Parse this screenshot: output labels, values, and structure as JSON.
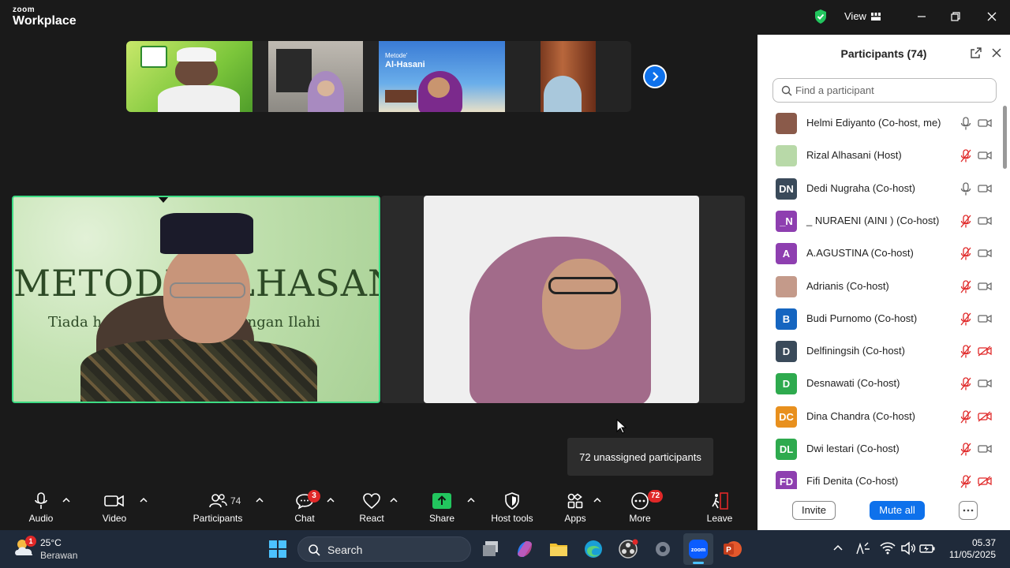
{
  "app": {
    "brand_top": "zoom",
    "brand_bottom": "Workplace",
    "view_label": "View"
  },
  "main": {
    "tooltip": "72 unassigned participants"
  },
  "toolbar": {
    "audio": "Audio",
    "video": "Video",
    "participants": "Participants",
    "participants_count": "74",
    "chat": "Chat",
    "chat_badge": "3",
    "react": "React",
    "share": "Share",
    "host_tools": "Host tools",
    "apps": "Apps",
    "more": "More",
    "more_badge": "72",
    "leave": "Leave"
  },
  "panel": {
    "title": "Participants (74)",
    "search_placeholder": "Find a participant",
    "invite": "Invite",
    "mute_all": "Mute all",
    "participants": [
      {
        "name": "Helmi Ediyanto (Co-host, me)",
        "initials": "",
        "color": "#8a5a4a",
        "mic": "on",
        "cam": "on"
      },
      {
        "name": "Rizal Alhasani (Host)",
        "initials": "",
        "color": "#b8d9a8",
        "mic": "muted",
        "cam": "on"
      },
      {
        "name": "Dedi  Nugraha (Co-host)",
        "initials": "DN",
        "color": "#3a4a5a",
        "mic": "on",
        "cam": "on"
      },
      {
        "name": "_ NURAENI (AINI ) (Co-host)",
        "initials": "_N",
        "color": "#8e3fb0",
        "mic": "muted",
        "cam": "on"
      },
      {
        "name": "A.AGUSTINA (Co-host)",
        "initials": "A",
        "color": "#8e3fb0",
        "mic": "muted",
        "cam": "on"
      },
      {
        "name": "Adrianis (Co-host)",
        "initials": "",
        "color": "#c49a8a",
        "mic": "muted",
        "cam": "on"
      },
      {
        "name": "Budi Purnomo (Co-host)",
        "initials": "B",
        "color": "#1565c0",
        "mic": "muted",
        "cam": "on"
      },
      {
        "name": "Delfiningsih (Co-host)",
        "initials": "D",
        "color": "#3a4a5a",
        "mic": "muted",
        "cam": "off"
      },
      {
        "name": "Desnawati (Co-host)",
        "initials": "D",
        "color": "#2eaa4e",
        "mic": "muted",
        "cam": "on"
      },
      {
        "name": "Dina Chandra (Co-host)",
        "initials": "DC",
        "color": "#e8901e",
        "mic": "muted",
        "cam": "off"
      },
      {
        "name": "Dwi lestari (Co-host)",
        "initials": "DL",
        "color": "#2eaa4e",
        "mic": "muted",
        "cam": "on"
      },
      {
        "name": "Fifi Denita (Co-host)",
        "initials": "FD",
        "color": "#8e3fb0",
        "mic": "muted",
        "cam": "off"
      }
    ]
  },
  "taskbar": {
    "temp": "25°C",
    "weather": "Berawan",
    "weather_badge": "1",
    "search": "Search",
    "time": "05.37",
    "date": "11/05/2025"
  },
  "slide": {
    "headline": "METODE ALHASANI",
    "tagline": "Tiada henti mengharap naungan Ilahi",
    "thumb_title_small": "Metode'",
    "thumb_title": "Al-Hasani"
  }
}
